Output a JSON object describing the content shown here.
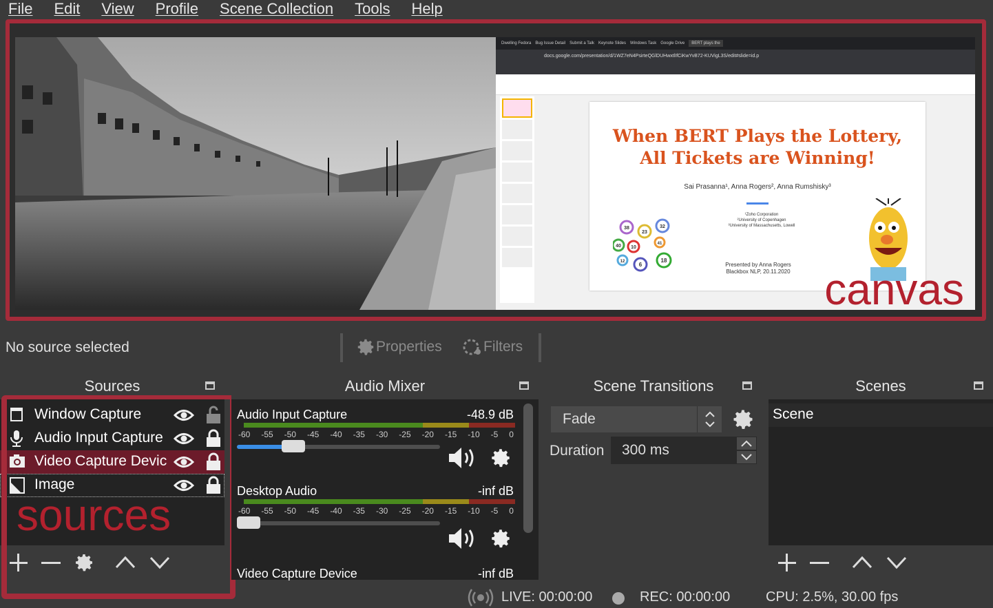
{
  "menu": [
    "File",
    "Edit",
    "View",
    "Profile",
    "Scene Collection",
    "Tools",
    "Help"
  ],
  "preview": {
    "browser_tabs": [
      "Dwelling Fedora",
      "Bug Issue Detail",
      "Submit a Talk",
      "Keynote Slides",
      "Windows Task",
      "Google Drive",
      "BERT plays the"
    ],
    "address": "docs.google.com/presentation/d/1WZ7eN4PsirteQGlDUHwxtlIfCiKwYvB72-KUVigL3S/edit#slide=id.p",
    "slide": {
      "title_line1": "When BERT Plays the Lottery,",
      "title_line2": "All Tickets are Winning!",
      "authors": "Sai Prasanna¹, Anna Rogers², Anna Rumshisky³",
      "affil1": "¹Zoho Corporation",
      "affil2": "²University of Copenhagen",
      "affil3": "³University of Massachusetts, Lowell",
      "presented_by": "Presented by Anna Rogers",
      "event": "Blackbox NLP, 20.11.2020",
      "balls": [
        "38",
        "23",
        "32",
        "40",
        "10",
        "41",
        "12",
        "6",
        "18"
      ]
    },
    "annotation": "canvas"
  },
  "source_toolbar": {
    "status": "No source selected",
    "properties": "Properties",
    "filters": "Filters"
  },
  "sources": {
    "title": "Sources",
    "items": [
      {
        "label": "Window Capture",
        "icon": "window-icon"
      },
      {
        "label": "Audio Input Capture",
        "icon": "microphone-icon"
      },
      {
        "label": "Video Capture Device",
        "icon": "camera-icon"
      },
      {
        "label": "Image",
        "icon": "image-icon"
      }
    ],
    "annotation": "sources"
  },
  "audio_mixer": {
    "title": "Audio Mixer",
    "channels": [
      {
        "name": "Audio Input Capture",
        "db": "-48.9 dB",
        "volume": 0.25
      },
      {
        "name": "Desktop Audio",
        "db": "-inf dB",
        "volume": 0.0
      },
      {
        "name": "Video Capture Device",
        "db": "-inf dB"
      }
    ],
    "ticks": [
      "-60",
      "-55",
      "-50",
      "-45",
      "-40",
      "-35",
      "-30",
      "-25",
      "-20",
      "-15",
      "-10",
      "-5",
      "0"
    ]
  },
  "scene_transitions": {
    "title": "Scene Transitions",
    "transition": "Fade",
    "duration_label": "Duration",
    "duration_value": "300 ms"
  },
  "scenes": {
    "title": "Scenes",
    "items": [
      "Scene"
    ]
  },
  "statusbar": {
    "live": "LIVE: 00:00:00",
    "rec": "REC: 00:00:00",
    "cpu": "CPU: 2.5%, 30.00 fps"
  },
  "colors": {
    "accent_red": "#a52b3a",
    "selected_row": "#6c1b2a",
    "slider_blue": "#3a8ee6"
  }
}
